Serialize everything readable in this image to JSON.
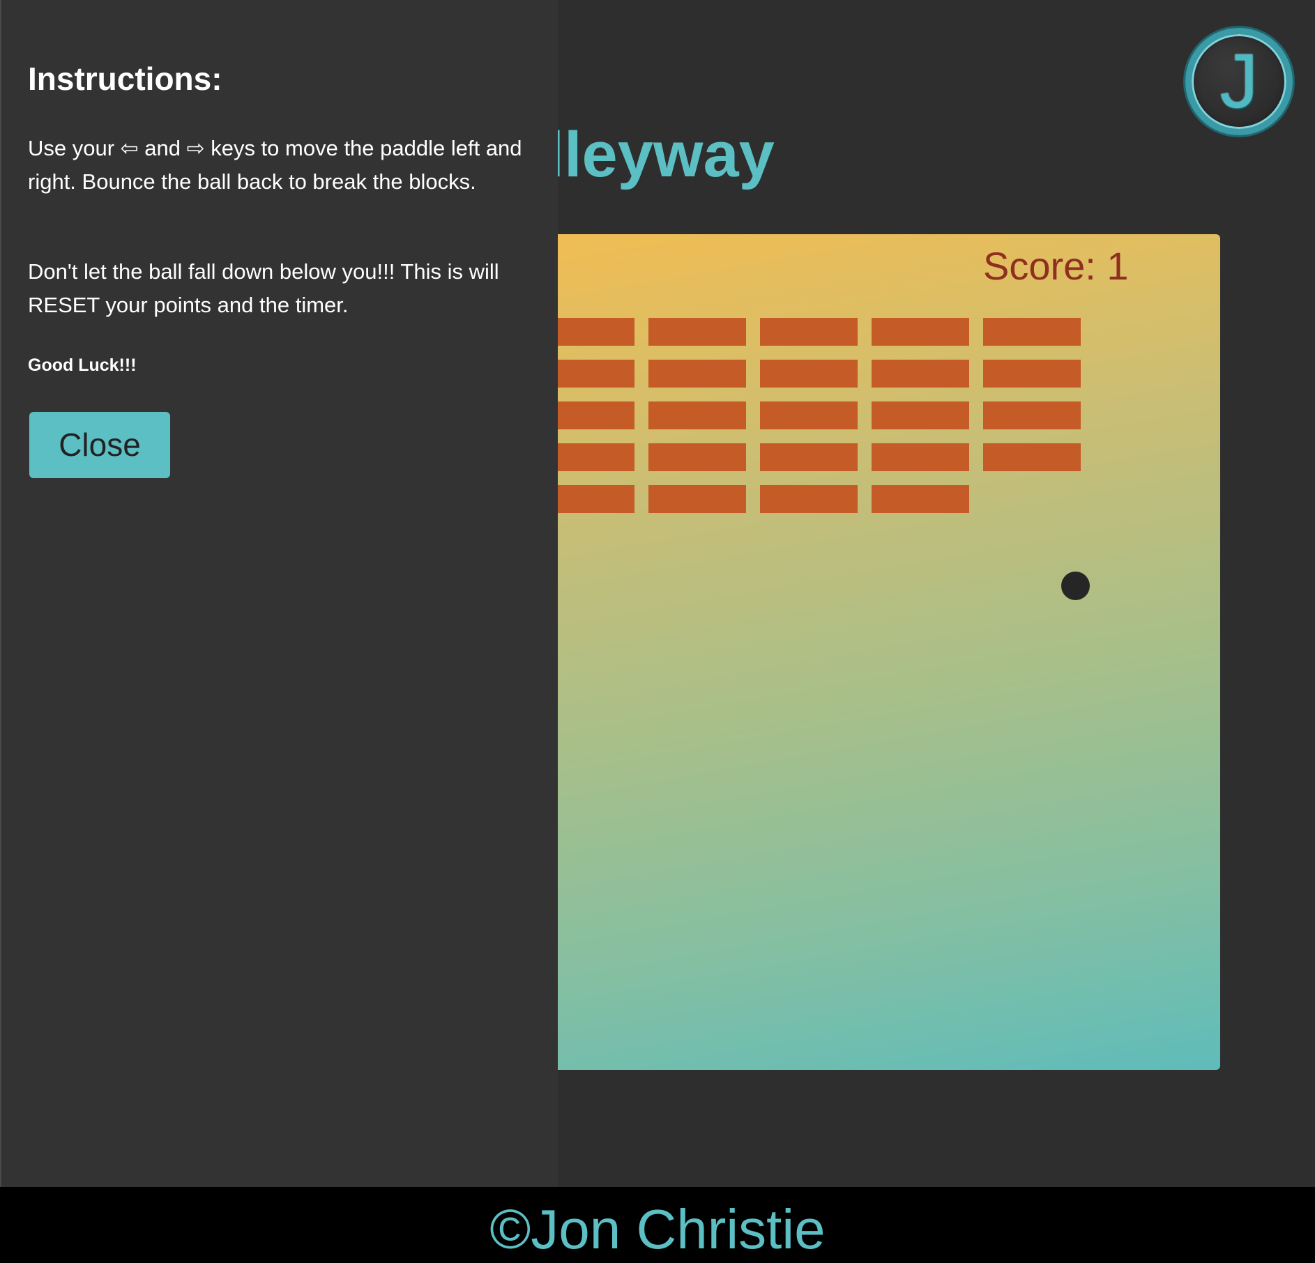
{
  "logo": {
    "letter": "J"
  },
  "title": "Alleyway",
  "game": {
    "score_label": "Score:",
    "score_value": "1",
    "bricks": {
      "rows": [
        6,
        6,
        6,
        6,
        5
      ],
      "color": "#c55b27"
    },
    "ball_color": "#262626",
    "background_colors": [
      "#f2bd52",
      "#a4bf8c",
      "#5fbcba"
    ]
  },
  "instructions": {
    "heading": "Instructions:",
    "para1_before": "Use your ",
    "para1_left_arrow": "⇦",
    "para1_and": " and ",
    "para1_right_arrow": "⇨",
    "para1_after": " keys to move the paddle left and right. Bounce the ball back to break the blocks.",
    "para2": "Don't let the ball fall down below you!!! This is will RESET your points and the timer.",
    "para3": "Good Luck!!!",
    "close_label": "Close"
  },
  "footer": {
    "text": "©Jon Christie"
  },
  "colors": {
    "accent": "#5cbfc4",
    "page_background": "#2e2e2e",
    "panel_background": "#333333",
    "footer_background": "#000000",
    "score_text": "#8f2f20"
  }
}
